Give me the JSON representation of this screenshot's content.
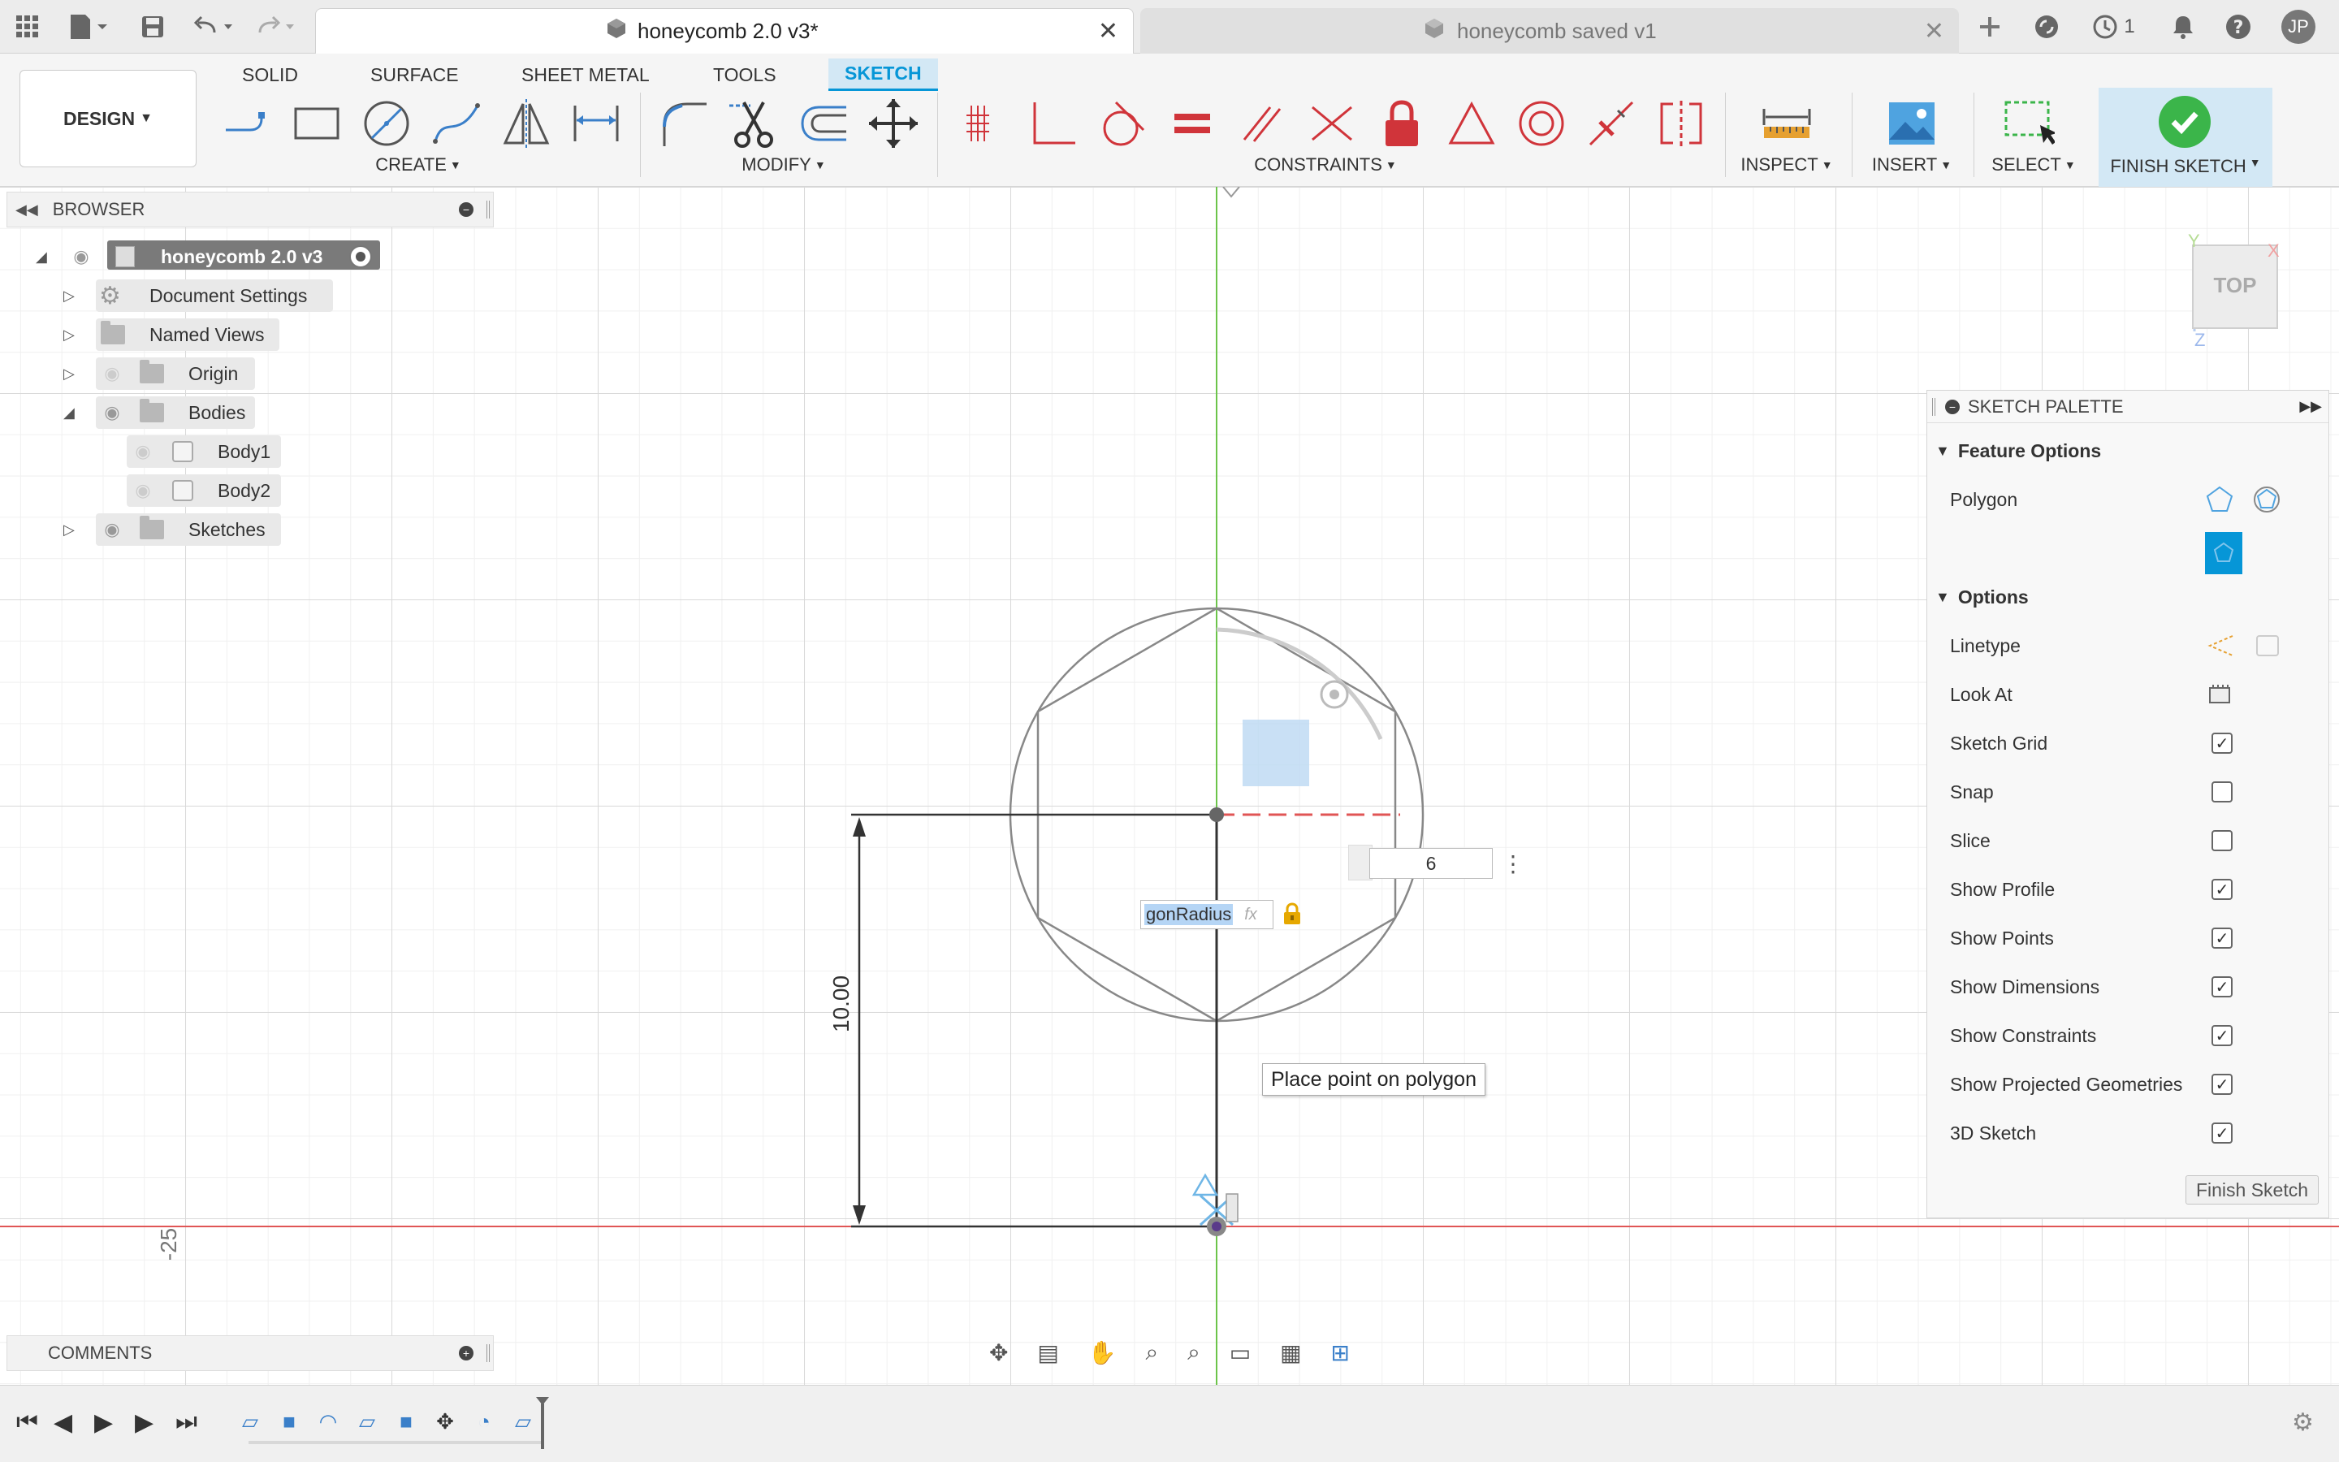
{
  "titlebar": {
    "active_tab": "honeycomb 2.0 v3*",
    "inactive_tab": "honeycomb saved v1",
    "jobs_count": "1",
    "user_initials": "JP"
  },
  "ribbon": {
    "workspace": "DESIGN",
    "tabs": [
      "SOLID",
      "SURFACE",
      "SHEET METAL",
      "TOOLS",
      "SKETCH"
    ],
    "groups": {
      "create": "CREATE",
      "modify": "MODIFY",
      "constraints": "CONSTRAINTS",
      "inspect": "INSPECT",
      "insert": "INSERT",
      "select": "SELECT",
      "finish": "FINISH SKETCH"
    }
  },
  "browser": {
    "title": "BROWSER",
    "root": "honeycomb 2.0 v3",
    "items": {
      "doc_settings": "Document Settings",
      "named_views": "Named Views",
      "origin": "Origin",
      "bodies": "Bodies",
      "body1": "Body1",
      "body2": "Body2",
      "sketches": "Sketches"
    }
  },
  "viewcube": {
    "face": "TOP",
    "x": "X",
    "y": "Y",
    "z": "Z"
  },
  "canvas": {
    "dimension_vertical": "10.00",
    "axis_label": "-25",
    "sides_value": "6",
    "radius_param": "gonRadius",
    "fx": "fx",
    "tooltip": "Place point on polygon"
  },
  "palette": {
    "title": "SKETCH PALETTE",
    "feature_options": "Feature Options",
    "polygon_label": "Polygon",
    "options": "Options",
    "linetype": "Linetype",
    "look_at": "Look At",
    "rows": [
      {
        "label": "Sketch Grid",
        "checked": true
      },
      {
        "label": "Snap",
        "checked": false
      },
      {
        "label": "Slice",
        "checked": false
      },
      {
        "label": "Show Profile",
        "checked": true
      },
      {
        "label": "Show Points",
        "checked": true
      },
      {
        "label": "Show Dimensions",
        "checked": true
      },
      {
        "label": "Show Constraints",
        "checked": true
      },
      {
        "label": "Show Projected Geometries",
        "checked": true
      },
      {
        "label": "3D Sketch",
        "checked": true
      }
    ],
    "finish_button": "Finish Sketch"
  },
  "comments": {
    "title": "COMMENTS"
  },
  "colors": {
    "accent": "#0696d7",
    "finish_green": "#3bb54a",
    "constraint_red": "#d0343a",
    "axis_green": "#6cc44a",
    "axis_red": "#e05555"
  }
}
